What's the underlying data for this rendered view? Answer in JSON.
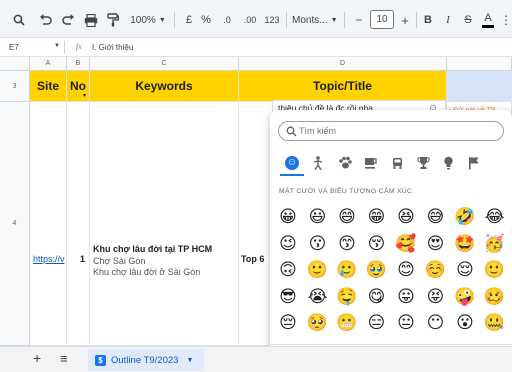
{
  "toolbar": {
    "zoom": "100%",
    "percent": "%",
    "decimal_dec": ".0",
    "decimal_inc": ".00",
    "number_format": "123",
    "font": "Monts...",
    "font_size": "10",
    "bold": "B",
    "italic": "I",
    "text_color": "A"
  },
  "formula_bar": {
    "cell_ref": "E7",
    "fx": "fx",
    "content": "I. Giới thiệu"
  },
  "columns": [
    "A",
    "B",
    "C",
    "D"
  ],
  "rows": [
    "3",
    "4"
  ],
  "headers": {
    "site": "Site",
    "no": "No",
    "keywords": "Keywords",
    "topic": "Topic/Title"
  },
  "row4": {
    "site": "https://v",
    "no": "1",
    "kw_main": "Khu chợ lâu đời tại TP HCM",
    "kw_2": "Chợ Sài Gòn",
    "kw_3": "Khu chợ lâu đời ở Sài Gòn",
    "topic": "Top 6",
    "snippet": "thiêu chủ đề là đc rồi nha",
    "side_note": "- Đôi nét về TP"
  },
  "sheet_tab": {
    "label": "Outline T9/2023",
    "add": "+",
    "menu": "≡"
  },
  "emoji_picker": {
    "search_placeholder": "Tìm kiếm",
    "section_title": "MẶT CƯỜI VÀ BIỂU TƯỢNG CẢM XÚC",
    "categories": [
      {
        "icon": "😊",
        "name": "smileys-category-icon"
      },
      {
        "icon": "🚶",
        "name": "people-category-icon"
      },
      {
        "icon": "🐾",
        "name": "nature-category-icon"
      },
      {
        "icon": "☕",
        "name": "food-category-icon"
      },
      {
        "icon": "🚗",
        "name": "travel-category-icon"
      },
      {
        "icon": "🏆",
        "name": "activity-category-icon"
      },
      {
        "icon": "💡",
        "name": "objects-category-icon"
      },
      {
        "icon": "🚩",
        "name": "flags-category-icon"
      }
    ],
    "rows": [
      [
        "😀",
        "😃",
        "😄",
        "😁",
        "😆",
        "😅",
        "🤣",
        "😂"
      ],
      [
        "😉",
        "😗",
        "😙",
        "😚",
        "🥰",
        "😍",
        "🤩",
        "🥳"
      ],
      [
        "🙃",
        "🙂",
        "🥲",
        "🥹",
        "😊",
        "☺️",
        "😌",
        "🙂"
      ],
      [
        "😎",
        "😭",
        "🤤",
        "😋",
        "😛",
        "😝",
        "🤪",
        "🥴"
      ],
      [
        "😔",
        "🥺",
        "😬",
        "😑",
        "😐",
        "😶",
        "😮",
        "🤐"
      ]
    ],
    "bottom_row": [
      "👍",
      "👏",
      "🙂",
      "😂",
      "😣",
      "😡",
      "🎉",
      "➕"
    ]
  }
}
